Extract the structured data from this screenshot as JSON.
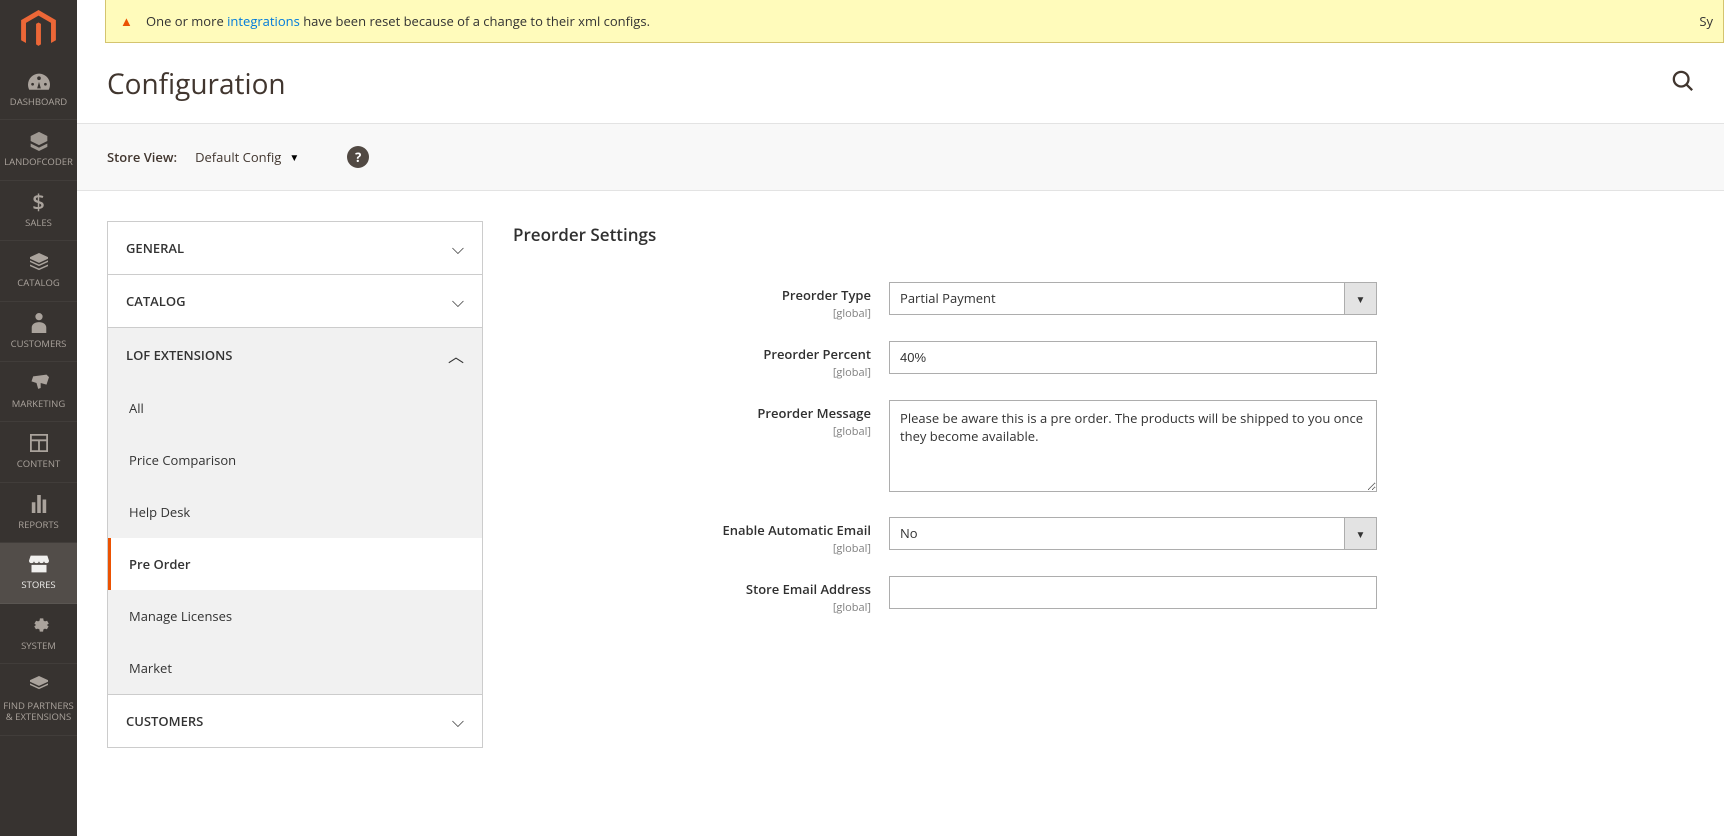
{
  "sidebar": {
    "items": [
      {
        "label": "DASHBOARD",
        "icon": "dashboard"
      },
      {
        "label": "LANDOFCODER",
        "icon": "lof"
      },
      {
        "label": "SALES",
        "icon": "sales"
      },
      {
        "label": "CATALOG",
        "icon": "catalog"
      },
      {
        "label": "CUSTOMERS",
        "icon": "customers"
      },
      {
        "label": "MARKETING",
        "icon": "marketing"
      },
      {
        "label": "CONTENT",
        "icon": "content"
      },
      {
        "label": "REPORTS",
        "icon": "reports"
      },
      {
        "label": "STORES",
        "icon": "stores"
      },
      {
        "label": "SYSTEM",
        "icon": "system"
      },
      {
        "label": "FIND PARTNERS & EXTENSIONS",
        "icon": "partners"
      }
    ],
    "active_index": 8
  },
  "notice": {
    "prefix": "One or more ",
    "link": "integrations",
    "suffix": " have been reset because of a change to their xml configs.",
    "sys": "Sy"
  },
  "page": {
    "title": "Configuration"
  },
  "scope": {
    "label": "Store View:",
    "value": "Default Config",
    "help": "?"
  },
  "config_nav": {
    "sections": [
      {
        "label": "GENERAL",
        "open": false
      },
      {
        "label": "CATALOG",
        "open": false
      },
      {
        "label": "LOF EXTENSIONS",
        "open": true,
        "items": [
          {
            "label": "All"
          },
          {
            "label": "Price Comparison"
          },
          {
            "label": "Help Desk"
          },
          {
            "label": "Pre Order",
            "active": true
          },
          {
            "label": "Manage Licenses"
          },
          {
            "label": "Market"
          }
        ]
      },
      {
        "label": "CUSTOMERS",
        "open": false
      }
    ]
  },
  "form": {
    "title": "Preorder Settings",
    "scope_text": "[global]",
    "fields": {
      "preorder_type": {
        "label": "Preorder Type",
        "value": "Partial Payment"
      },
      "preorder_percent": {
        "label": "Preorder Percent",
        "value": "40%"
      },
      "preorder_message": {
        "label": "Preorder Message",
        "value": "Please be aware this is a pre order. The products will be shipped to you once they become available."
      },
      "enable_auto_email": {
        "label": "Enable Automatic Email",
        "value": "No"
      },
      "store_email": {
        "label": "Store Email Address",
        "value": ""
      }
    }
  }
}
